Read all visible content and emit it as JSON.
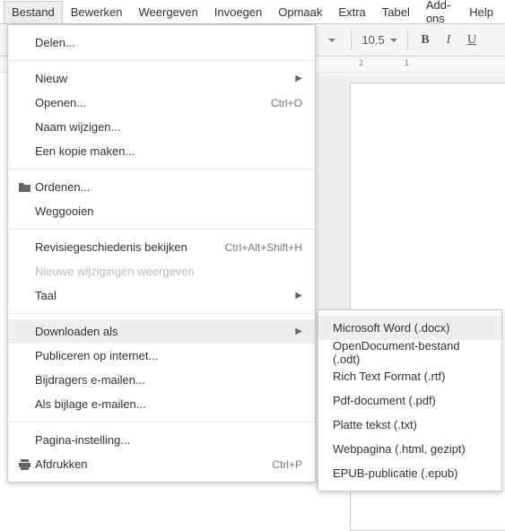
{
  "menubar": [
    "Bestand",
    "Bewerken",
    "Weergeven",
    "Invoegen",
    "Opmaak",
    "Extra",
    "Tabel",
    "Add-ons",
    "Help"
  ],
  "toolbar": {
    "font_size": "10.5",
    "bold": "B",
    "italic": "I",
    "underline": "U"
  },
  "ruler": {
    "mark1": "2",
    "mark2": "1"
  },
  "file_menu": {
    "share": "Delen...",
    "new": "Nieuw",
    "open": "Openen...",
    "open_shortcut": "Ctrl+O",
    "rename": "Naam wijzigen...",
    "make_copy": "Een kopie maken...",
    "organize": "Ordenen...",
    "trash": "Weggooien",
    "revision_history": "Revisiegeschiedenis bekijken",
    "revision_shortcut": "Ctrl+Alt+Shift+H",
    "show_new_changes": "Nieuwe wijzigingen weergeven",
    "language": "Taal",
    "download_as": "Downloaden als",
    "publish": "Publiceren op internet...",
    "email_collaborators": "Bijdragers e-mailen...",
    "email_attachment": "Als bijlage e-mailen...",
    "page_setup": "Pagina-instelling...",
    "print": "Afdrukken",
    "print_shortcut": "Ctrl+P"
  },
  "download_submenu": [
    "Microsoft Word (.docx)",
    "OpenDocument-bestand (.odt)",
    "Rich Text Format (.rtf)",
    "Pdf-document (.pdf)",
    "Platte tekst (.txt)",
    "Webpagina (.html, gezipt)",
    "EPUB-publicatie (.epub)"
  ]
}
